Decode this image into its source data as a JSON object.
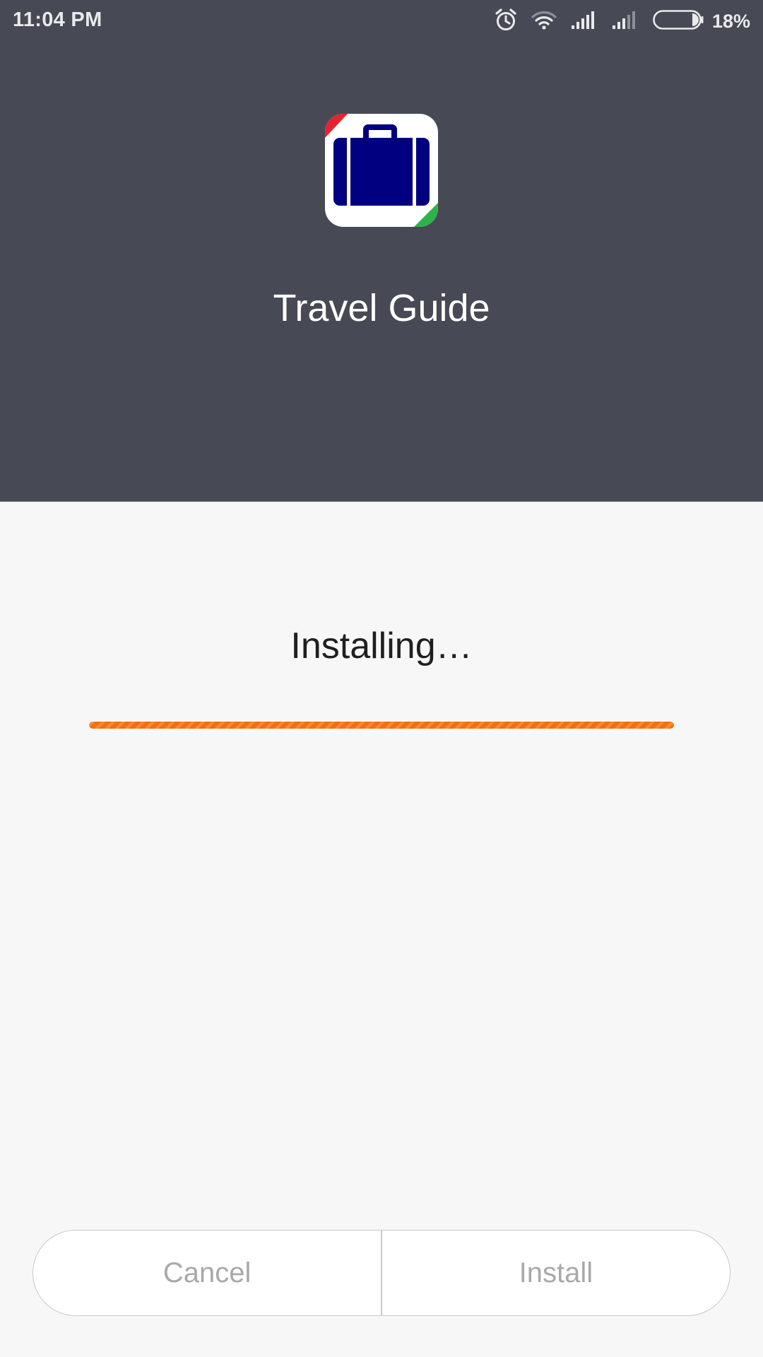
{
  "status_bar": {
    "time": "11:04 PM",
    "battery_percent_label": "18%",
    "battery_level": 0.18,
    "icons": [
      "alarm-icon",
      "wifi-icon",
      "cell-signal-icon",
      "cell-signal-2-icon",
      "battery-icon"
    ]
  },
  "app": {
    "name": "Travel Guide",
    "icon": "suitcase-icon",
    "icon_colors": {
      "background": "#ffffff",
      "suitcase": "#000080",
      "corner_top_left": "#e8222e",
      "corner_bottom_right": "#2db34a"
    }
  },
  "install": {
    "status": "Installing…",
    "progress": 1.0,
    "progress_color": "#f56f0c"
  },
  "buttons": {
    "cancel_label": "Cancel",
    "install_label": "Install"
  },
  "colors": {
    "header_background": "#474a54",
    "body_background": "#f7f7f7",
    "button_text_disabled": "#a9a9a9"
  }
}
